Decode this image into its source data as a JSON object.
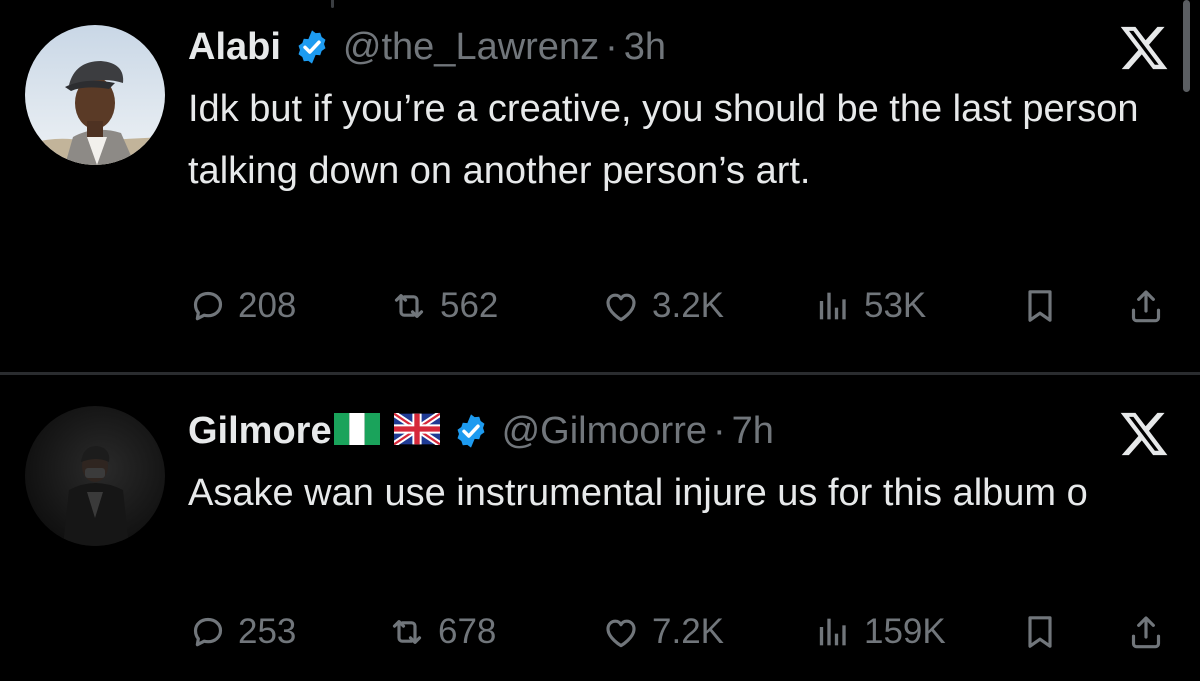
{
  "tweets": [
    {
      "name": "Alabi",
      "handle": "@the_Lawrenz",
      "separator": "·",
      "time": "3h",
      "text": "Idk but if you’re a creative, you should be the last person talking down on another person’s art.",
      "stats": {
        "replies": "208",
        "reposts": "562",
        "likes": "3.2K",
        "views": "53K"
      }
    },
    {
      "name": "Gilmore",
      "flags": [
        "nigeria-flag",
        "uk-flag"
      ],
      "handle": "@Gilmoorre",
      "separator": "·",
      "time": "7h",
      "text": "Asake wan use instrumental injure us for this album o",
      "stats": {
        "replies": "253",
        "reposts": "678",
        "likes": "7.2K",
        "views": "159K"
      }
    }
  ],
  "icons": {
    "reply": "reply-icon",
    "repost": "repost-icon",
    "like": "heart-icon",
    "views": "views-icon",
    "bookmark": "bookmark-icon",
    "share": "share-icon",
    "verified": "verified-badge-icon",
    "brand": "x-logo-icon"
  },
  "colors": {
    "background": "#000000",
    "text": "#e7e9ea",
    "muted": "#71767b",
    "verified": "#1d9bf0"
  }
}
